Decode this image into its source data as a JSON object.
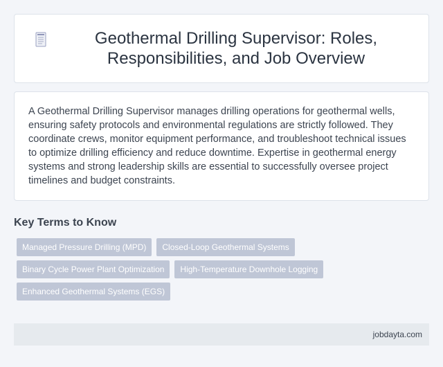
{
  "header": {
    "icon": "document-icon",
    "title": "Geothermal Drilling Supervisor: Roles, Responsibilities, and Job Overview"
  },
  "intro": {
    "text": "A Geothermal Drilling Supervisor manages drilling operations for geothermal wells, ensuring safety protocols and environmental regulations are strictly followed. They coordinate crews, monitor equipment performance, and troubleshoot technical issues to optimize drilling efficiency and reduce downtime. Expertise in geothermal energy systems and strong leadership skills are essential to successfully oversee project timelines and budget constraints."
  },
  "key_terms": {
    "heading": "Key Terms to Know",
    "tags": [
      "Managed Pressure Drilling (MPD)",
      "Closed-Loop Geothermal Systems",
      "Binary Cycle Power Plant Optimization",
      "High-Temperature Downhole Logging",
      "Enhanced Geothermal Systems (EGS)"
    ]
  },
  "footer": {
    "site": "jobdayta.com"
  },
  "colors": {
    "background": "#f3f5f9",
    "card": "#ffffff",
    "tag": "#bfc6d6",
    "footer": "#e6eaee",
    "text": "#3c4450"
  }
}
